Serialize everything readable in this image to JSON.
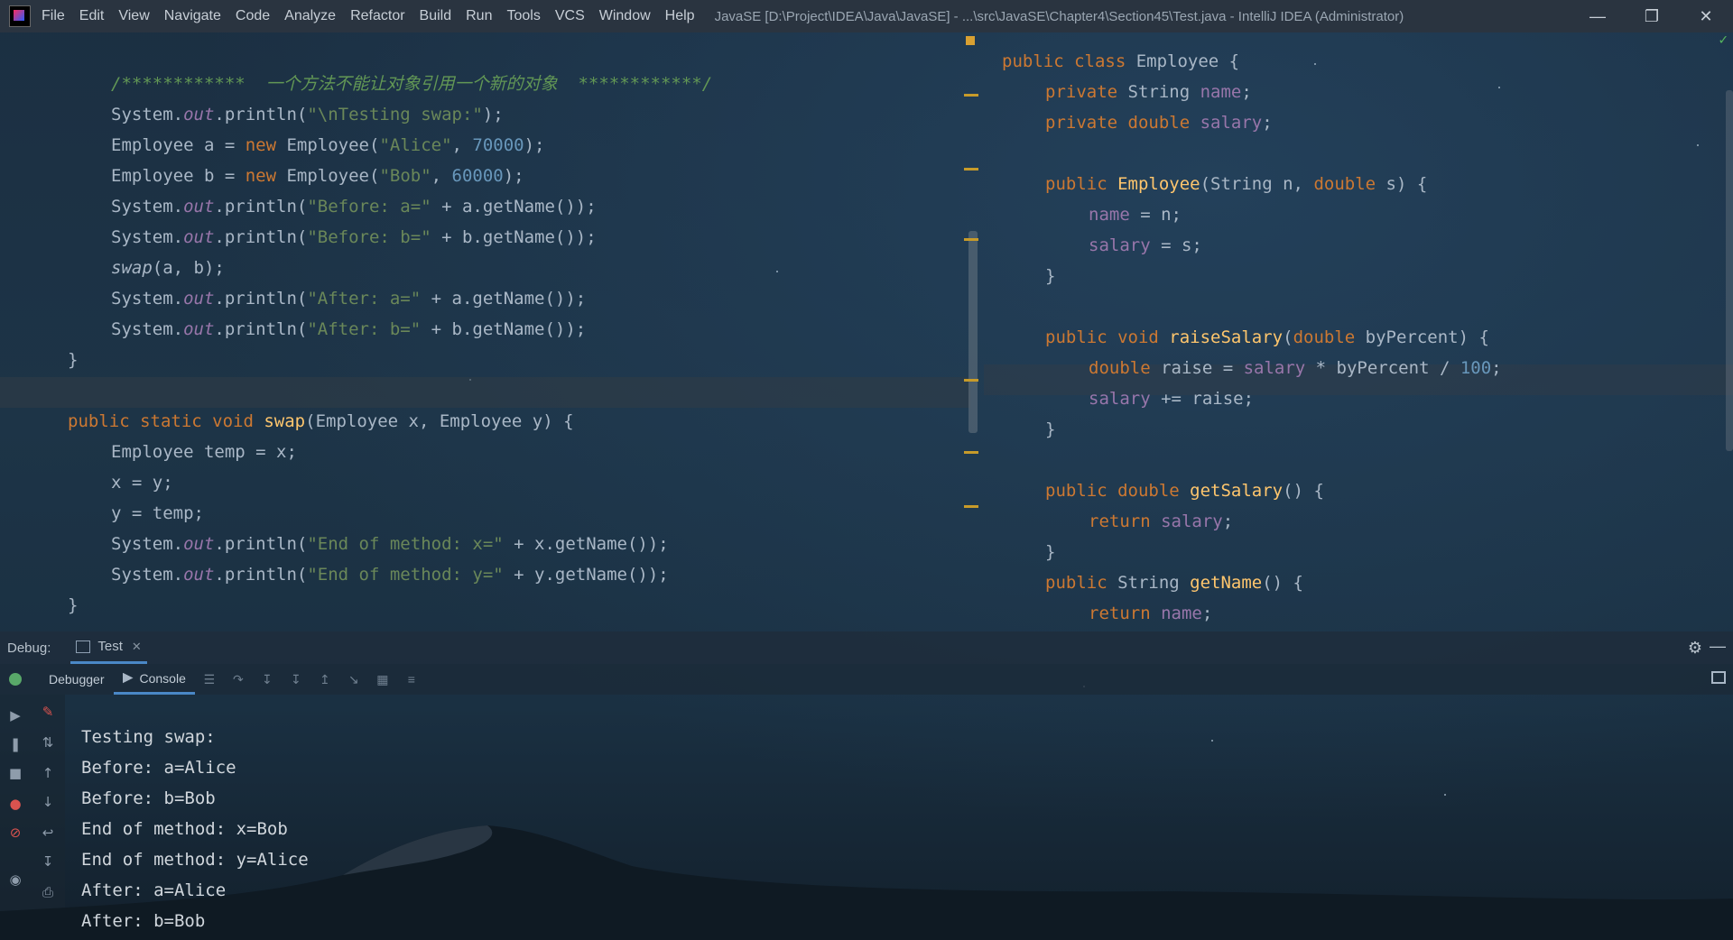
{
  "titlebar": {
    "menu": [
      "File",
      "Edit",
      "View",
      "Navigate",
      "Code",
      "Analyze",
      "Refactor",
      "Build",
      "Run",
      "Tools",
      "VCS",
      "Window",
      "Help"
    ],
    "window_title": "JavaSE [D:\\Project\\IDEA\\Java\\JavaSE] - ...\\src\\JavaSE\\Chapter4\\Section45\\Test.java - IntelliJ IDEA (Administrator)",
    "controls": [
      "minimize-icon",
      "restore-icon",
      "close-icon"
    ]
  },
  "left_editor": {
    "comment": "/************  一个方法不能让对象引用一个新的对象  ************/",
    "lines": [
      "    System.out.println(\"\\nTesting swap:\");",
      "    Employee a = new Employee(\"Alice\", 70000);",
      "    Employee b = new Employee(\"Bob\", 60000);",
      "    System.out.println(\"Before: a=\" + a.getName());",
      "    System.out.println(\"Before: b=\" + b.getName());",
      "    swap(a, b);",
      "    System.out.println(\"After: a=\" + a.getName());",
      "    System.out.println(\"After: b=\" + b.getName());",
      "}",
      "",
      "public static void swap(Employee x, Employee y) {",
      "    Employee temp = x;",
      "    x = y;",
      "    y = temp;",
      "    System.out.println(\"End of method: x=\" + x.getName());",
      "    System.out.println(\"End of method: y=\" + y.getName());",
      "}"
    ]
  },
  "right_editor": {
    "lines": [
      "public class Employee {",
      "    private String name;",
      "    private double salary;",
      "",
      "    public Employee(String n, double s) {",
      "        name = n;",
      "        salary = s;",
      "    }",
      "",
      "    public void raiseSalary(double byPercent) {",
      "        double raise = salary * byPercent / 100;",
      "        salary += raise;",
      "    }",
      "",
      "    public double getSalary() {",
      "        return salary;",
      "    }",
      "    public String getName() {",
      "        return name;",
      "    }"
    ]
  },
  "debug": {
    "label": "Debug:",
    "run_tab": "Test",
    "tabs": [
      "Debugger",
      "Console"
    ],
    "active_tab": "Console",
    "console_output": [
      "Testing swap:",
      "Before: a=Alice",
      "Before: b=Bob",
      "End of method: x=Bob",
      "End of method: y=Alice",
      "After: a=Alice",
      "After: b=Bob"
    ]
  },
  "colors": {
    "keyword": "#cc7832",
    "string": "#6a8759",
    "number": "#6897bb",
    "field": "#9876aa",
    "method": "#ffc66d",
    "comment": "#629755",
    "accent": "#4a88c7"
  }
}
